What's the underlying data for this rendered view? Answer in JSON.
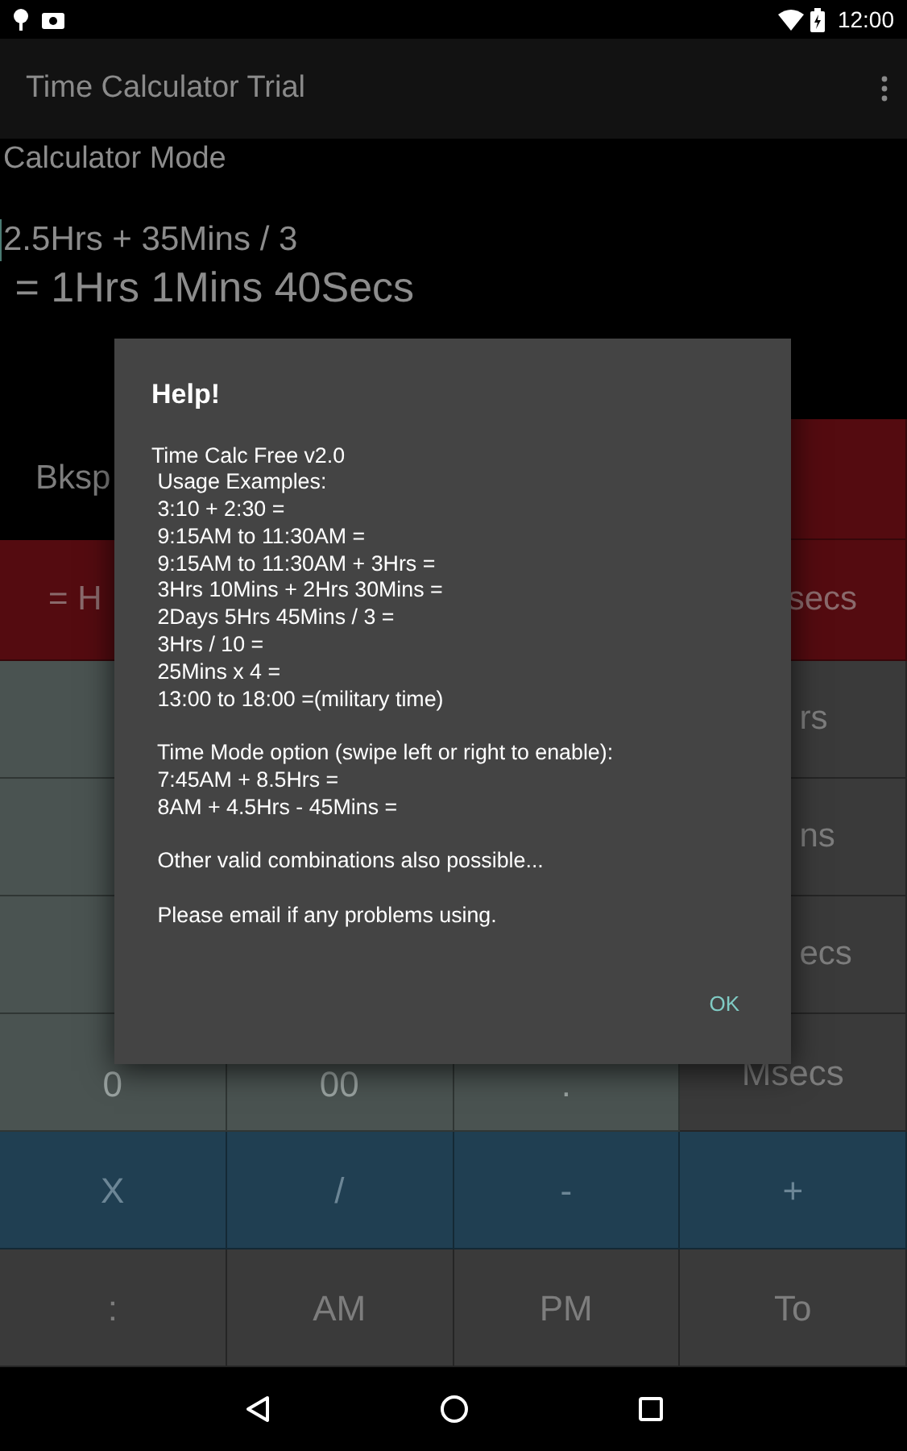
{
  "status_bar": {
    "time": "12:00"
  },
  "app_bar": {
    "title": "Time Calculator Trial"
  },
  "display": {
    "mode_label": "Calculator Mode",
    "expression": "2.5Hrs + 35Mins / 3",
    "result": " = 1Hrs 1Mins 40Secs"
  },
  "keypad": [
    {
      "keys": [
        {
          "label": "Bksp",
          "kind": "control",
          "clipped": true
        },
        {
          "kind": "function"
        }
      ]
    },
    {
      "keys": [
        {
          "label": "= H",
          "kind": "function",
          "clipped": true
        },
        {
          "label": "secs",
          "kind": "function",
          "clipped": true
        }
      ]
    },
    {
      "keys": [
        {
          "kind": "digit"
        },
        {
          "label": "rs",
          "kind": "unit",
          "clipped": true
        }
      ]
    },
    {
      "keys": [
        {
          "kind": "digit"
        },
        {
          "label": "ns",
          "kind": "unit",
          "clipped": true
        }
      ]
    },
    {
      "keys": [
        {
          "kind": "digit"
        },
        {
          "label": "ecs",
          "kind": "unit",
          "clipped": true
        }
      ]
    },
    {
      "keys": [
        {
          "label": "0",
          "kind": "digit"
        },
        {
          "label": "00",
          "kind": "digit"
        },
        {
          "label": ".",
          "kind": "digit"
        },
        {
          "label": "Msecs",
          "kind": "unit"
        }
      ]
    },
    {
      "keys": [
        {
          "label": "X",
          "kind": "operator"
        },
        {
          "label": "/",
          "kind": "operator"
        },
        {
          "label": "-",
          "kind": "operator"
        },
        {
          "label": "+",
          "kind": "operator"
        }
      ]
    },
    {
      "keys": [
        {
          "label": ":",
          "kind": "time"
        },
        {
          "label": "AM",
          "kind": "time"
        },
        {
          "label": "PM",
          "kind": "time"
        },
        {
          "label": "To",
          "kind": "time"
        }
      ]
    }
  ],
  "dialog": {
    "title": "Help!",
    "paragraphs": [
      {
        "lines": [
          "Time Calc Free v2.0",
          " Usage Examples:",
          " 3:10 + 2:30 =",
          " 9:15AM to 11:30AM =",
          " 9:15AM to 11:30AM + 3Hrs =",
          " 3Hrs 10Mins + 2Hrs 30Mins =",
          " 2Days 5Hrs 45Mins / 3 =",
          " 3Hrs / 10 =",
          " 25Mins x 4 =",
          " 13:00 to 18:00 =(military time)"
        ]
      },
      {
        "lines": [
          " Time Mode option (swipe left or right to enable):",
          " 7:45AM + 8.5Hrs =",
          " 8AM + 4.5Hrs - 45Mins ="
        ]
      },
      {
        "lines": [
          " Other valid combinations also possible..."
        ]
      },
      {
        "lines": [
          " Please email if any problems using."
        ]
      }
    ],
    "button": "OK"
  }
}
